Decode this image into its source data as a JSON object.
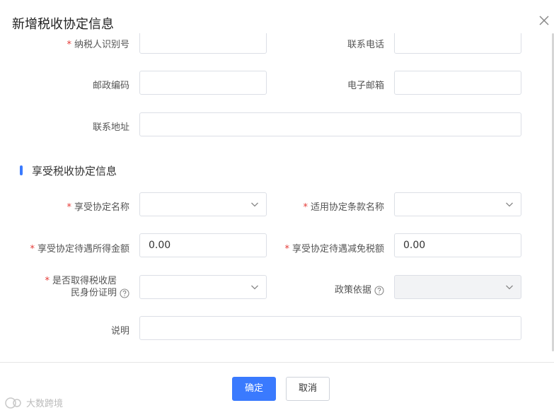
{
  "dialog": {
    "title": "新增税收协定信息"
  },
  "taxpayer": {
    "id_label": "纳税人识别号",
    "phone_label": "联系电话",
    "postcode_label": "邮政编码",
    "email_label": "电子邮箱",
    "address_label": "联系地址"
  },
  "section": {
    "title": "享受税收协定信息"
  },
  "agreement": {
    "name_label": "享受协定名称",
    "clause_label": "适用协定条款名称",
    "income_label": "享受协定待遇所得金额",
    "income_value": "0.00",
    "relief_label": "享受协定待遇减免税额",
    "relief_value": "0.00",
    "cert_label_line1": "是否取得税收居",
    "cert_label_line2": "民身份证明",
    "policy_label": "政策依据",
    "note_label": "说明"
  },
  "footer": {
    "confirm_label": "确定",
    "cancel_label": "取消"
  },
  "watermark": {
    "text": "大数跨境"
  },
  "colors": {
    "primary": "#3a7afe",
    "required": "#e53935",
    "border": "#dcdfe6",
    "disabled_bg": "#f2f3f5"
  }
}
